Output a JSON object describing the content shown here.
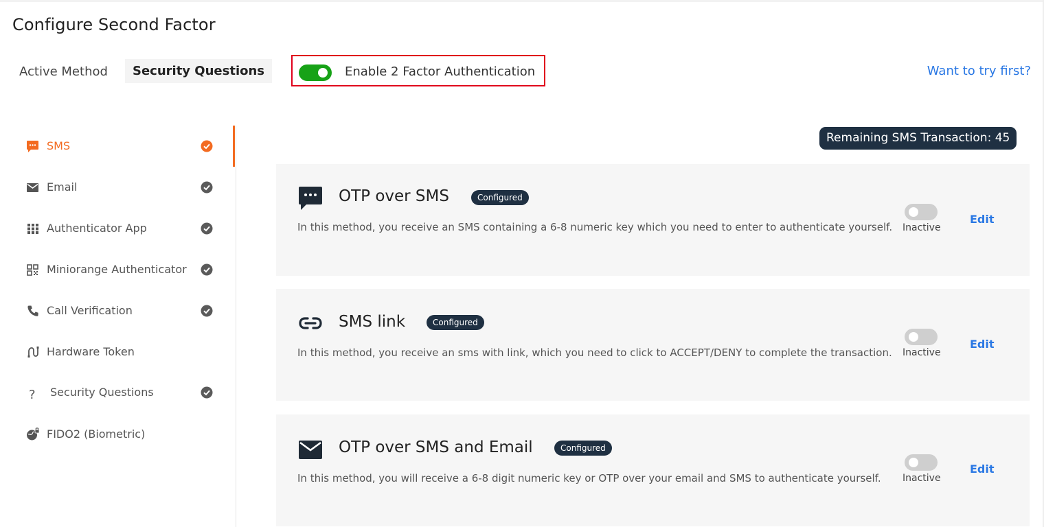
{
  "page": {
    "title": "Configure Second Factor"
  },
  "active_method": {
    "label": "Active Method",
    "value": "Security Questions"
  },
  "enable_2fa": {
    "label": "Enable 2 Factor Authentication",
    "enabled": true,
    "color": "#17a217"
  },
  "try_link": "Want to try first?",
  "sidebar": {
    "items": [
      {
        "label": "SMS",
        "icon": "sms-icon",
        "checked": true,
        "active": true
      },
      {
        "label": "Email",
        "icon": "email-icon",
        "checked": true
      },
      {
        "label": "Authenticator App",
        "icon": "grid-icon",
        "checked": true
      },
      {
        "label": "Miniorange Authenticator",
        "icon": "qr-icon",
        "checked": true
      },
      {
        "label": "Call Verification",
        "icon": "phone-icon",
        "checked": true
      },
      {
        "label": "Hardware Token",
        "icon": "token-icon",
        "checked": false
      },
      {
        "label": "Security Questions",
        "icon": "question-icon",
        "checked": true
      },
      {
        "label": "FIDO2 (Biometric)",
        "icon": "globe-lock-icon",
        "checked": false
      }
    ]
  },
  "remaining": "Remaining SMS Transaction: 45",
  "methods": [
    {
      "title": "OTP over SMS",
      "badge": "Configured",
      "icon": "chat-bubble-icon",
      "desc": "In this method, you receive an SMS containing a 6-8 numeric key which you need to enter to authenticate yourself.",
      "status": "Inactive",
      "edit": "Edit"
    },
    {
      "title": "SMS link",
      "badge": "Configured",
      "icon": "link-icon",
      "desc": "In this method, you receive an sms with link, which you need to click to ACCEPT/DENY to complete the transaction.",
      "status": "Inactive",
      "edit": "Edit"
    },
    {
      "title": "OTP over SMS and Email",
      "badge": "Configured",
      "icon": "envelope-icon",
      "desc": "In this method, you will receive a 6-8 digit numeric key or OTP over your email and SMS to authenticate yourself.",
      "status": "Inactive",
      "edit": "Edit"
    }
  ],
  "colors": {
    "accent": "#f36b21",
    "link": "#2a78e4",
    "badge": "#1f3042",
    "check": "#5a5a5a"
  }
}
